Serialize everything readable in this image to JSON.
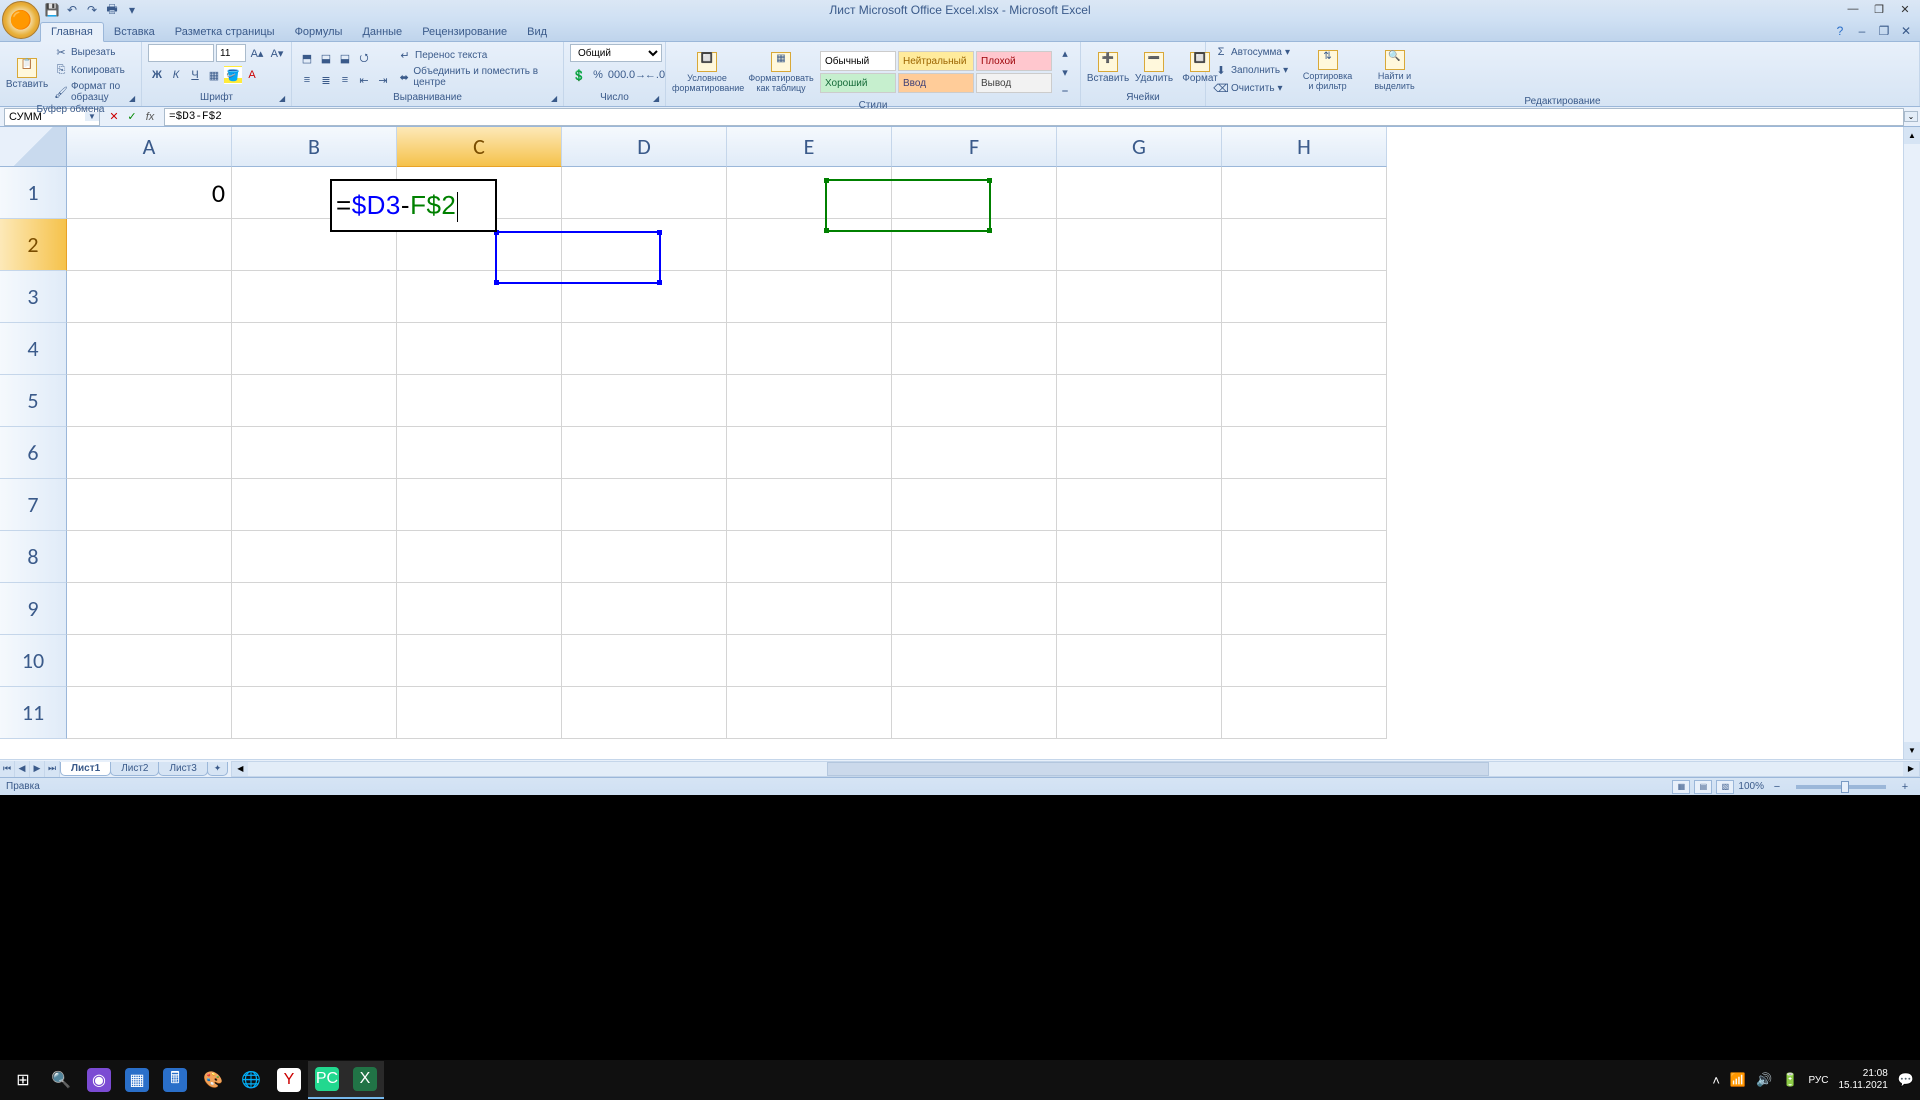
{
  "title": "Лист Microsoft Office Excel.xlsx - Microsoft Excel",
  "tabs": [
    "Главная",
    "Вставка",
    "Разметка страницы",
    "Формулы",
    "Данные",
    "Рецензирование",
    "Вид"
  ],
  "active_tab": 0,
  "ribbon": {
    "clipboard": {
      "label": "Буфер обмена",
      "paste": "Вставить",
      "cut": "Вырезать",
      "copy": "Копировать",
      "format_painter": "Формат по образцу"
    },
    "font": {
      "label": "Шрифт",
      "font_name": "",
      "font_size": "11"
    },
    "alignment": {
      "label": "Выравнивание",
      "wrap": "Перенос текста",
      "merge": "Объединить и поместить в центре"
    },
    "number": {
      "label": "Число",
      "format": "Общий"
    },
    "styles": {
      "label": "Стили",
      "cond": "Условное форматирование",
      "table": "Форматировать как таблицу",
      "items": [
        "Обычный",
        "Нейтральный",
        "Плохой",
        "Хороший",
        "Ввод",
        "Вывод"
      ]
    },
    "cells": {
      "label": "Ячейки",
      "insert": "Вставить",
      "delete": "Удалить",
      "format": "Формат"
    },
    "editing": {
      "label": "Редактирование",
      "sum": "Автосумма",
      "fill": "Заполнить",
      "clear": "Очистить",
      "sort": "Сортировка и фильтр",
      "find": "Найти и выделить"
    }
  },
  "name_box": "СУММ",
  "formula_bar": "=$D3-F$2",
  "columns": [
    "A",
    "B",
    "C",
    "D",
    "E",
    "F",
    "G",
    "H"
  ],
  "rows": [
    "1",
    "2",
    "3",
    "4",
    "5",
    "6",
    "7",
    "8",
    "9",
    "10",
    "11"
  ],
  "active_col": "C",
  "active_row": "2",
  "cells": {
    "A1": "0"
  },
  "editing": {
    "cell": "C2",
    "prefix": "=",
    "ref1": "$D3",
    "op": "-",
    "ref2": "F$2"
  },
  "sheet_tabs": [
    "Лист1",
    "Лист2",
    "Лист3"
  ],
  "active_sheet": 0,
  "status": "Правка",
  "zoom": "100%",
  "taskbar": {
    "lang": "РУС",
    "time": "21:08",
    "date": "15.11.2021"
  }
}
